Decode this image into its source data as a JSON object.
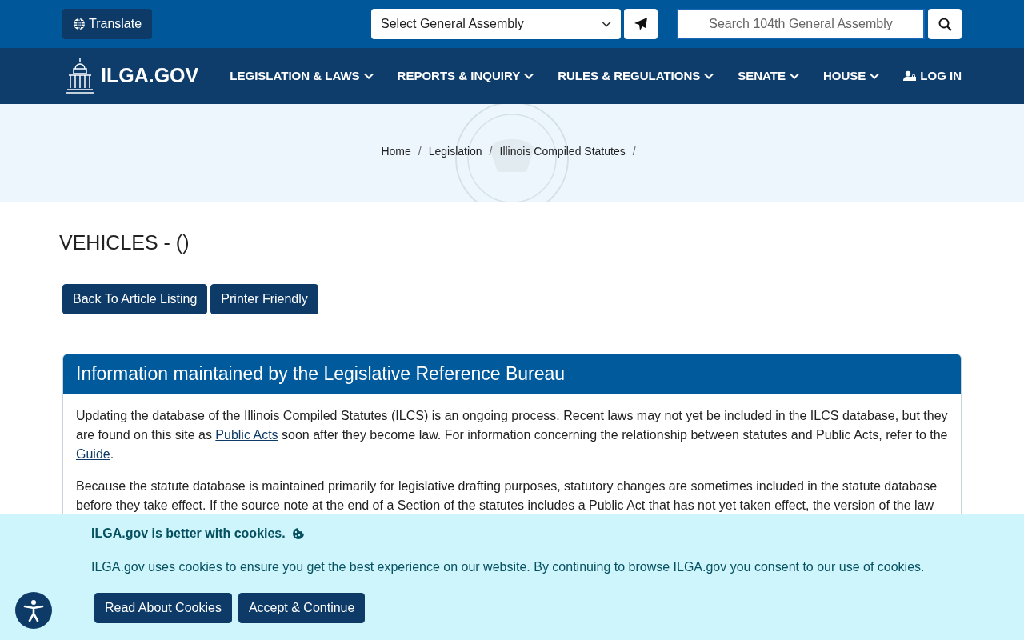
{
  "top_bar": {
    "translate_label": "Translate",
    "assembly_select": "Select General Assembly",
    "search": {
      "placeholder": "Search 104th General Assembly"
    }
  },
  "navbar": {
    "brand": "ILGA.GOV",
    "items": [
      {
        "label": "LEGISLATION & LAWS",
        "kind": "dropdown"
      },
      {
        "label": "REPORTS & INQUIRY",
        "kind": "dropdown"
      },
      {
        "label": "RULES & REGULATIONS",
        "kind": "dropdown"
      },
      {
        "label": "SENATE",
        "kind": "dropdown"
      },
      {
        "label": "HOUSE",
        "kind": "dropdown"
      },
      {
        "label": "LOG IN",
        "kind": "login"
      }
    ]
  },
  "breadcrumb": {
    "items": [
      "Home",
      "Legislation",
      "Illinois Compiled Statutes"
    ],
    "separator": "/"
  },
  "page_title": "VEHICLES - ()",
  "buttons": [
    "Back To Article Listing",
    "Printer Friendly"
  ],
  "info_card": {
    "title": "Information maintained by the Legislative Reference Bureau",
    "paragraphs": [
      [
        {
          "text": "Updating the database of the Illinois Compiled Statutes (ILCS) is an ongoing process. Recent laws may not yet be included in the ILCS database, but they are found on this site as "
        },
        {
          "text": "Public Acts",
          "link": true
        },
        {
          "text": " soon after they become law. For information concerning the relationship between statutes and Public Acts, refer to the "
        },
        {
          "text": "Guide",
          "link": true
        },
        {
          "text": "."
        }
      ],
      [
        {
          "text": "Because the statute database is maintained primarily for legislative drafting purposes, statutory changes are sometimes included in the statute database before they take effect. If the source note at the end of a Section of the statutes includes a Public Act that has not yet taken effect, the version of the law"
        }
      ]
    ]
  },
  "cookie_banner": {
    "title": "ILGA.gov is better with cookies.",
    "text": "ILGA.gov uses cookies to ensure you get the best experience on our website. By continuing to browse ILGA.gov you consent to our use of cookies.",
    "buttons": [
      "Read About Cookies",
      "Accept & Continue"
    ]
  }
}
